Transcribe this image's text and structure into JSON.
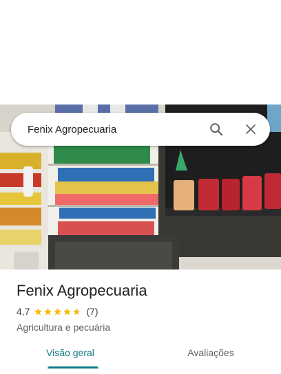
{
  "search": {
    "query": "Fenix Agropecuaria",
    "search_icon": "search-icon",
    "close_icon": "close-icon"
  },
  "place": {
    "name": "Fenix Agropecuaria",
    "rating": "4,7",
    "rating_value": 4.7,
    "rating_max": 5,
    "review_count": "(7)",
    "category": "Agricultura e pecuária"
  },
  "tabs": [
    {
      "label": "Visão geral",
      "active": true
    },
    {
      "label": "Avaliações",
      "active": false
    }
  ],
  "colors": {
    "accent": "#0e7c86",
    "star": "#fbbc04"
  }
}
